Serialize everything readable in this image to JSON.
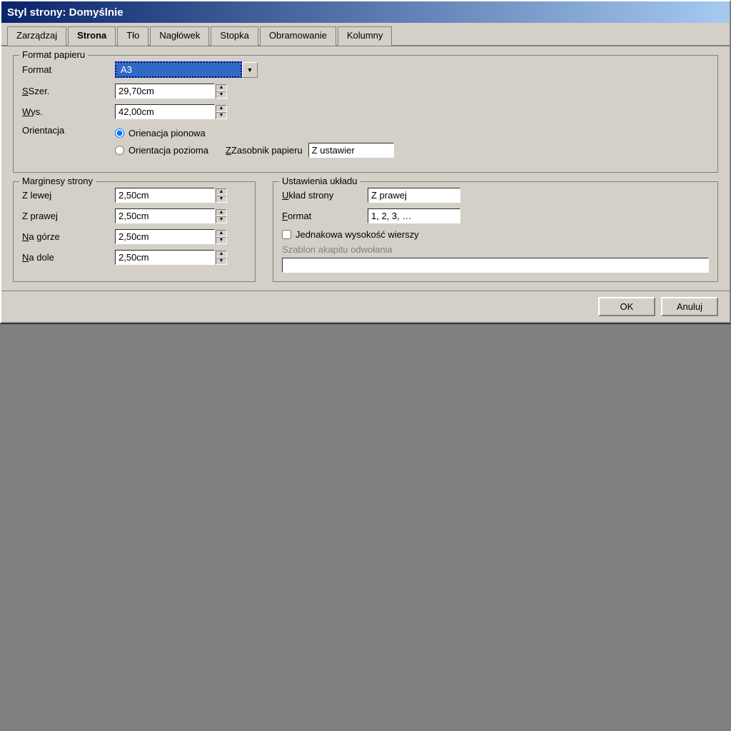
{
  "title_bar": {
    "title": "Styl strony: Domyślnie"
  },
  "tabs": [
    {
      "id": "zarzadzaj",
      "label": "Zarządzaj"
    },
    {
      "id": "strona",
      "label": "Strona",
      "active": true
    },
    {
      "id": "tlo",
      "label": "Tło"
    },
    {
      "id": "naglowek",
      "label": "Nagłówek"
    },
    {
      "id": "stopka",
      "label": "Stopka"
    },
    {
      "id": "obramowanie",
      "label": "Obramowanie"
    },
    {
      "id": "kolumny",
      "label": "Kolumny"
    }
  ],
  "paper_format": {
    "legend": "Format papieru",
    "format_label": "Format",
    "format_value": "A3",
    "width_label": "Szer.",
    "width_value": "29,70cm",
    "height_label": "Wys.",
    "height_value": "42,00cm",
    "orientation_label": "Orientacja",
    "orientation_portrait": "Orienacja pionowa",
    "orientation_landscape": "Orientacja pozioma",
    "paper_tray_label": "Zasobnik papieru",
    "paper_tray_value": "Z ustawier"
  },
  "margins": {
    "legend": "Marginesy strony",
    "left_label": "Z lewej",
    "left_value": "2,50cm",
    "right_label": "Z prawej",
    "right_value": "2,50cm",
    "top_label": "Na górze",
    "top_value": "2,50cm",
    "bottom_label": "Na dole",
    "bottom_value": "2,50cm"
  },
  "layout": {
    "legend": "Ustawienia układu",
    "page_layout_label": "Układ strony",
    "page_layout_value": "Z prawej",
    "format_label": "Format",
    "format_value": "1, 2, 3, …",
    "equal_height_label": "Jednakowa wysokość wierszy",
    "equal_height_checked": false,
    "ref_label": "Szablon akapitu odwołania",
    "ref_value": ""
  },
  "footer": {
    "ok_label": "OK",
    "cancel_label": "Anuluj"
  }
}
